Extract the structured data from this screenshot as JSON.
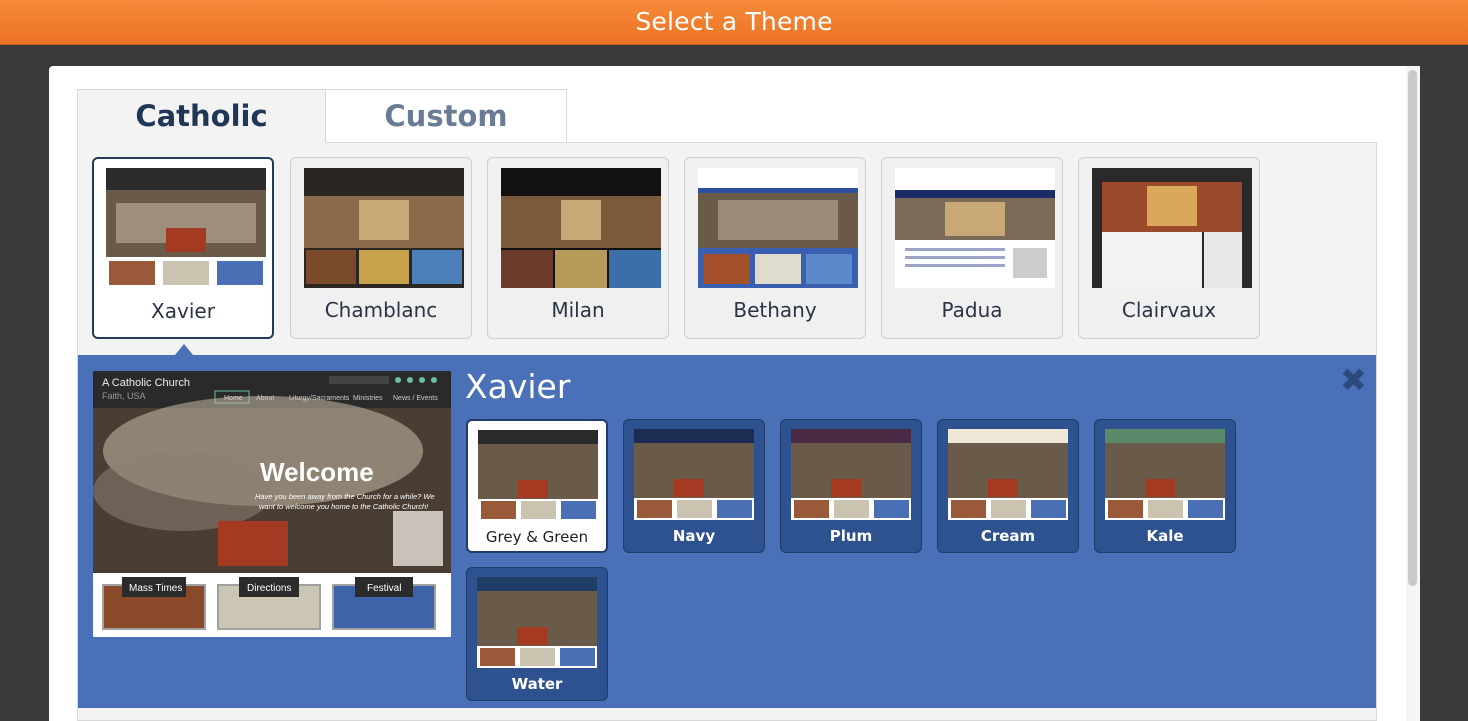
{
  "header": {
    "title": "Select a Theme"
  },
  "tabs": [
    {
      "label": "Catholic",
      "active": true
    },
    {
      "label": "Custom",
      "active": false
    }
  ],
  "themes": [
    {
      "name": "Xavier",
      "selected": true
    },
    {
      "name": "Chamblanc"
    },
    {
      "name": "Milan"
    },
    {
      "name": "Bethany"
    },
    {
      "name": "Padua"
    },
    {
      "name": "Clairvaux"
    }
  ],
  "detail": {
    "title": "Xavier",
    "close_icon": "close-icon",
    "preview": {
      "church_name": "A Catholic Church",
      "location": "Faith, USA",
      "nav": [
        "Home",
        "About",
        "Liturgy/Sacraments",
        "Ministries",
        "News / Events"
      ],
      "headline": "Welcome",
      "tagline_1": "Have you been away from the Church for a while? We",
      "tagline_2": "want to welcome you home to the Catholic Church!",
      "buttons": [
        "Mass Times",
        "Directions",
        "Festival"
      ]
    },
    "variants": [
      {
        "name": "Grey & Green",
        "selected": true,
        "color": "#2a2a2a"
      },
      {
        "name": "Navy",
        "color": "#1c2c52"
      },
      {
        "name": "Plum",
        "color": "#4a2a45"
      },
      {
        "name": "Cream",
        "color": "#efe8d8"
      },
      {
        "name": "Kale",
        "color": "#5a8a6a"
      },
      {
        "name": "Water",
        "color": "#1e3e66"
      }
    ]
  },
  "colors": {
    "header_orange": "#ef7a2a",
    "panel_blue": "#4a70b7",
    "navy_text": "#1f3656"
  }
}
